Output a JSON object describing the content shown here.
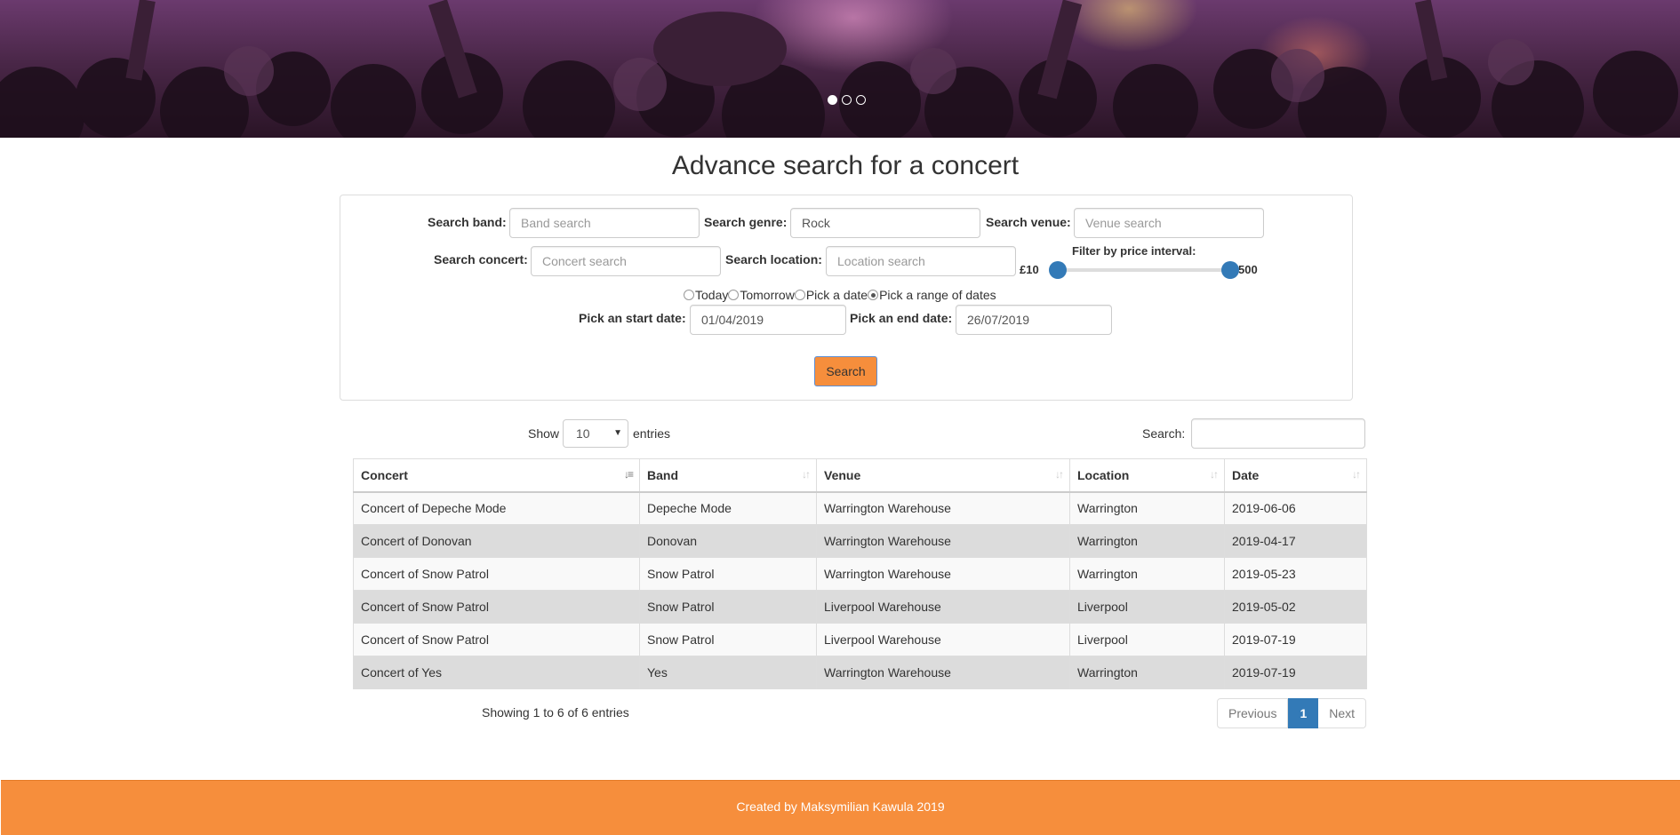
{
  "carousel": {
    "slides": 3,
    "active": 0
  },
  "page": {
    "title": "Advance search for a concert"
  },
  "search": {
    "band": {
      "label": "Search band:",
      "placeholder": "Band search",
      "value": ""
    },
    "genre": {
      "label": "Search genre:",
      "placeholder": "",
      "value": "Rock"
    },
    "venue": {
      "label": "Search venue:",
      "placeholder": "Venue search",
      "value": ""
    },
    "concert": {
      "label": "Search concert:",
      "placeholder": "Concert search",
      "value": ""
    },
    "location": {
      "label": "Search location:",
      "placeholder": "Location search",
      "value": ""
    },
    "price": {
      "label": "Filter by price interval:",
      "min_label": "£10",
      "max_label": "500",
      "min_value": 10,
      "max_value": 500
    },
    "date_options": [
      {
        "label": "Today",
        "checked": false
      },
      {
        "label": "Tomorrow",
        "checked": false
      },
      {
        "label": "Pick a date",
        "checked": false
      },
      {
        "label": "Pick a range of dates",
        "checked": true
      }
    ],
    "start_date": {
      "label": "Pick an start date:",
      "value": "01/04/2019"
    },
    "end_date": {
      "label": "Pick an end date:",
      "value": "26/07/2019"
    },
    "button_label": "Search"
  },
  "datatable": {
    "show_label": "Show",
    "entries_label": "entries",
    "page_length": "10",
    "filter_label": "Search:",
    "filter_value": "",
    "columns": [
      "Concert",
      "Band",
      "Venue",
      "Location",
      "Date"
    ],
    "rows": [
      [
        "Concert of Depeche Mode",
        "Depeche Mode",
        "Warrington Warehouse",
        "Warrington",
        "2019-06-06"
      ],
      [
        "Concert of Donovan",
        "Donovan",
        "Warrington Warehouse",
        "Warrington",
        "2019-04-17"
      ],
      [
        "Concert of Snow Patrol",
        "Snow Patrol",
        "Warrington Warehouse",
        "Warrington",
        "2019-05-23"
      ],
      [
        "Concert of Snow Patrol",
        "Snow Patrol",
        "Liverpool Warehouse",
        "Liverpool",
        "2019-05-02"
      ],
      [
        "Concert of Snow Patrol",
        "Snow Patrol",
        "Liverpool Warehouse",
        "Liverpool",
        "2019-07-19"
      ],
      [
        "Concert of Yes",
        "Yes",
        "Warrington Warehouse",
        "Warrington",
        "2019-07-19"
      ]
    ],
    "info": "Showing 1 to 6 of 6 entries",
    "pagination": {
      "previous": "Previous",
      "current": "1",
      "next": "Next"
    }
  },
  "footer": {
    "text": "Created by Maksymilian Kawula 2019"
  },
  "colors": {
    "accent": "#f68e3c",
    "primary": "#337ab7"
  }
}
